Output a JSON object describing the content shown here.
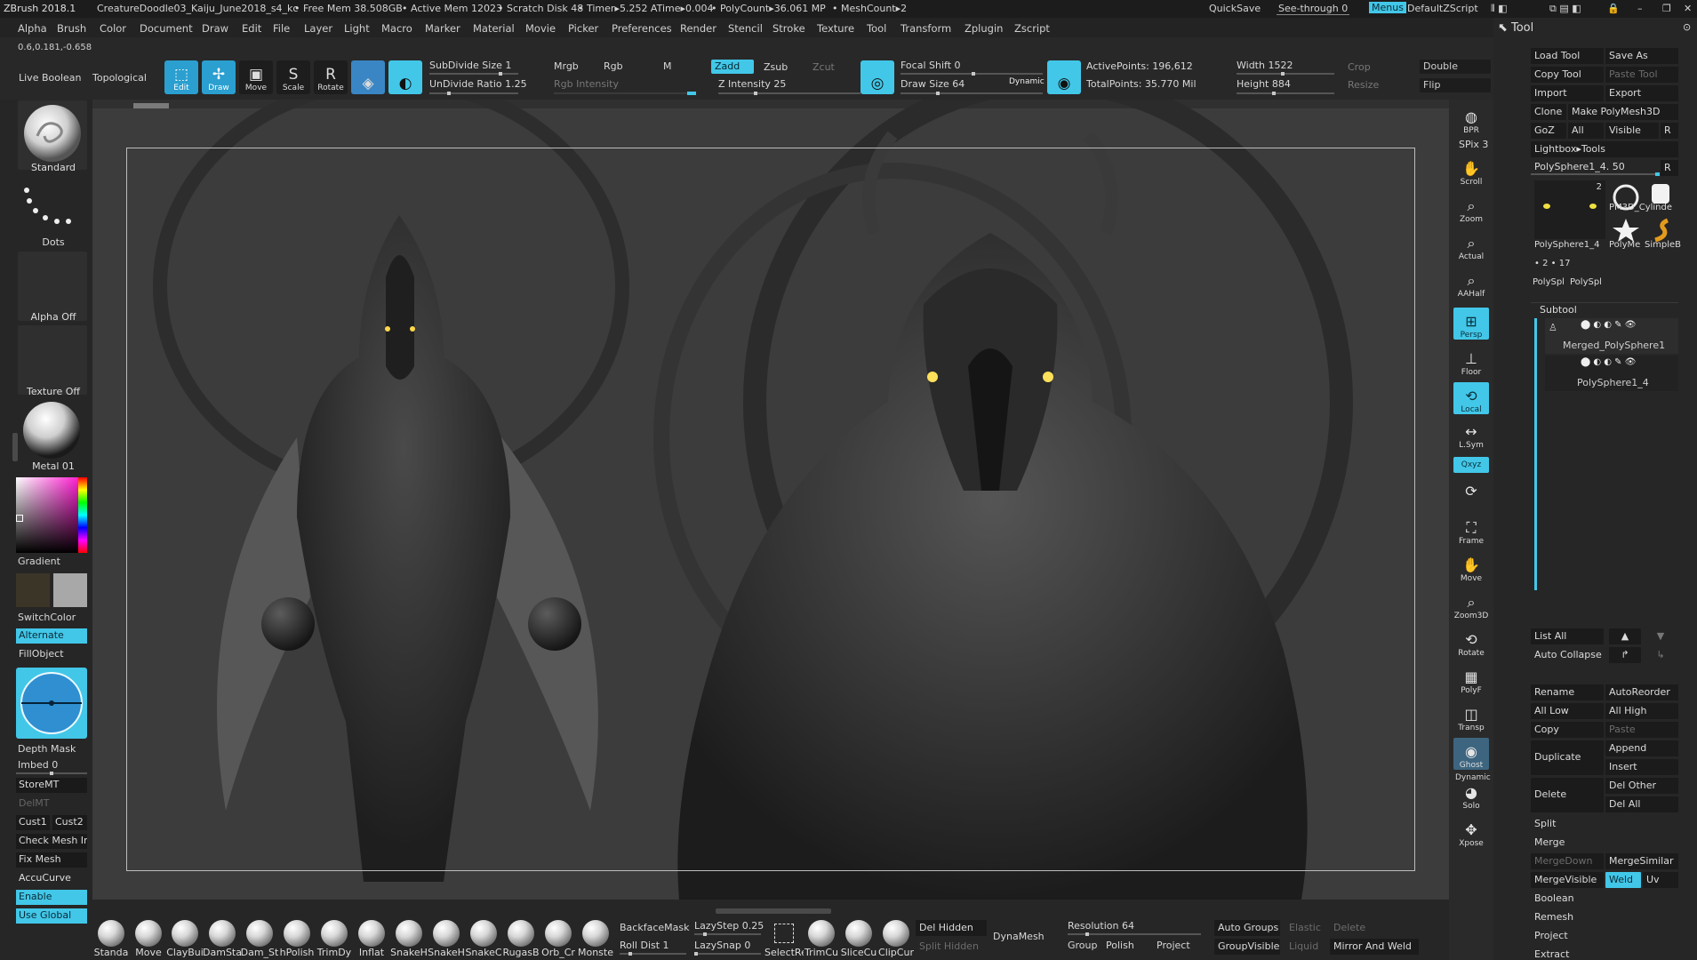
{
  "title_bar": {
    "app": "ZBrush 2018.1",
    "document": "CreatureDoodle03_Kaiju_June2018_s4_kc",
    "free_mem": "• Free Mem 38.508GB",
    "active_mem": "• Active Mem 12023",
    "scratch_disk": "• Scratch Disk 48",
    "timer": "• Timer▸5.252 ATime▸0.004",
    "polycount": "• PolyCount▸36.061 MP",
    "meshcount": "• MeshCount▸2",
    "quicksave": "QuickSave",
    "see_through": "See-through  0",
    "menus": "Menus",
    "default_zscript": "DefaultZScript"
  },
  "menu_bar": [
    "Alpha",
    "Brush",
    "Color",
    "Document",
    "Draw",
    "Edit",
    "File",
    "Layer",
    "Light",
    "Macro",
    "Marker",
    "Material",
    "Movie",
    "Picker",
    "Preferences",
    "Render",
    "Stencil",
    "Stroke",
    "Texture",
    "Tool",
    "Transform",
    "Zplugin",
    "Zscript"
  ],
  "top_shelf": {
    "coords": "0.6,0.181,-0.658",
    "live_boolean": "Live Boolean",
    "topological": "Topological",
    "edit": "Edit",
    "draw": "Draw",
    "move": "Move",
    "scale": "Scale",
    "rotate": "Rotate",
    "subdivide_size": "SubDivide Size 1",
    "undivide_ratio": "UnDivide Ratio 1.25",
    "mrgb": "Mrgb",
    "rgb": "Rgb",
    "m": "M",
    "rgb_intensity": "Rgb Intensity",
    "zadd": "Zadd",
    "zsub": "Zsub",
    "zcut": "Zcut",
    "z_intensity": "Z Intensity 25",
    "focal_shift": "Focal Shift 0",
    "draw_size": "Draw Size 64",
    "dynamic": "Dynamic",
    "active_points": "ActivePoints: 196,612",
    "total_points": "TotalPoints: 35.770 Mil",
    "width": "Width 1522",
    "height": "Height 884",
    "crop": "Crop",
    "resize": "Resize",
    "double": "Double",
    "flip": "Flip"
  },
  "left_shelf": {
    "brush": "Standard",
    "stroke": "Dots",
    "alpha": "Alpha Off",
    "texture": "Texture Off",
    "material": "Metal 01",
    "gradient": "Gradient",
    "switch_color": "SwitchColor",
    "alternate": "Alternate",
    "fill_object": "FillObject",
    "depth_mask": "Depth Mask",
    "imbed": "Imbed 0",
    "store_mt": "StoreMT",
    "del_mt": "DelMT",
    "cust1": "Cust1",
    "cust2": "Cust2",
    "check_mesh": "Check Mesh In",
    "fix_mesh": "Fix Mesh",
    "accucurve": "AccuCurve",
    "enable": "Enable",
    "use_global": "Use Global"
  },
  "right_nav": {
    "bpr": "BPR",
    "spix": "SPix 3",
    "scroll": "Scroll",
    "zoom": "Zoom",
    "actual": "Actual",
    "aahalf": "AAHalf",
    "persp": "Persp",
    "floor": "Floor",
    "local": "Local",
    "lsym": "L.Sym",
    "xyz": "Qxyz",
    "frame": "Frame",
    "move": "Move",
    "zoom3d": "Zoom3D",
    "rotate": "Rotate",
    "polyf": "PolyF",
    "transp": "Transp",
    "ghost": "Ghost",
    "dynamic": "Dynamic",
    "solo": "Solo",
    "xpose": "Xpose"
  },
  "tool_palette": {
    "header": "Tool",
    "load_tool": "Load Tool",
    "save_as": "Save As",
    "copy_tool": "Copy Tool",
    "paste_tool": "Paste Tool",
    "import": "Import",
    "export": "Export",
    "clone": "Clone",
    "make_polymesh": "Make PolyMesh3D",
    "goz": "GoZ",
    "all": "All",
    "visible": "Visible",
    "r": "R",
    "lightbox_tools": "Lightbox▸Tools",
    "current_tool": "PolySphere1_4. 50",
    "thumb_count": "2",
    "thumb_labels": [
      "PolySphere1_4",
      "PM3D_Cylinde",
      "PolyMe",
      "SimpleB"
    ],
    "small_row": [
      "PolySpl",
      "PolySpl"
    ],
    "small_counts": [
      "2",
      "17"
    ],
    "subtool_header": "Subtool",
    "subtools": [
      "Merged_PolySphere1",
      "PolySphere1_4"
    ],
    "list_all": "List All",
    "auto_collapse": "Auto Collapse",
    "rename": "Rename",
    "auto_reorder": "AutoReorder",
    "all_low": "All Low",
    "all_high": "All High",
    "copy": "Copy",
    "paste": "Paste",
    "append": "Append",
    "duplicate": "Duplicate",
    "insert": "Insert",
    "del_other": "Del Other",
    "delete": "Delete",
    "del_all": "Del All",
    "split": "Split",
    "merge": "Merge",
    "merge_down": "MergeDown",
    "merge_similar": "MergeSimilar",
    "merge_visible": "MergeVisible",
    "weld": "Weld",
    "uv": "Uv",
    "boolean": "Boolean",
    "remesh": "Remesh",
    "project": "Project",
    "extract": "Extract"
  },
  "bottom_shelf": {
    "brushes": [
      "Standa",
      "Move",
      "ClayBui",
      "DamSta",
      "Dam_St",
      "hPolish",
      "TrimDy",
      "Inflat",
      "SnakeH",
      "SnakeH",
      "SnakeC",
      "RugasB",
      "Orb_Cr",
      "Monste"
    ],
    "backface_mask": "BackfaceMask",
    "lazystep": "LazyStep 0.25",
    "roll_dist": "Roll Dist 1",
    "lazysnap": "LazySnap 0",
    "tools": [
      "SelectRe",
      "TrimCu",
      "SliceCu",
      "ClipCur"
    ],
    "del_hidden": "Del Hidden",
    "split_hidden": "Split Hidden",
    "dynamesh": "DynaMesh",
    "resolution": "Resolution 64",
    "group": "Group",
    "polish": "Polish",
    "project": "Project",
    "auto_groups": "Auto Groups",
    "elastic": "Elastic",
    "delete": "Delete",
    "group_visible": "GroupVisible",
    "liquid": "Liquid",
    "mirror_weld": "Mirror And Weld"
  },
  "colors": {
    "accent": "#42c7e8",
    "active_blue": "#2a9fd0",
    "canvas": "#3c3c3c",
    "panel": "#262626"
  }
}
